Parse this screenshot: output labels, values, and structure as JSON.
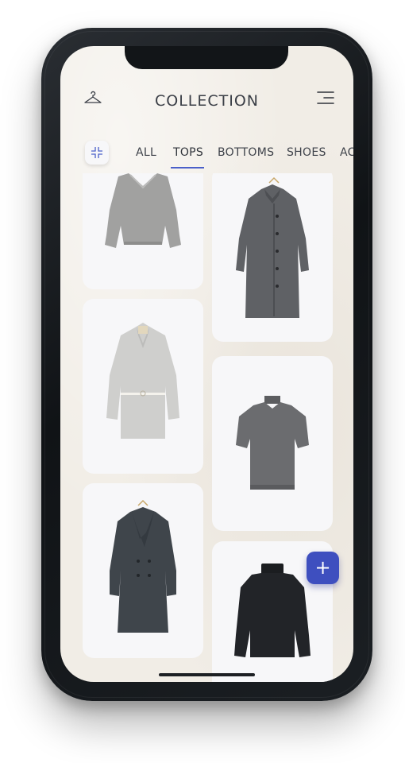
{
  "header": {
    "title": "COLLECTION",
    "left_icon": "hanger-icon",
    "right_icon": "menu-icon"
  },
  "filter_button": {
    "icon": "collapse-icon"
  },
  "tabs": [
    {
      "label": "ALL",
      "active": false
    },
    {
      "label": "TOPS",
      "active": true
    },
    {
      "label": "BOTTOMS",
      "active": false
    },
    {
      "label": "SHOES",
      "active": false
    },
    {
      "label": "AC",
      "active": false
    }
  ],
  "items": [
    {
      "kind": "grey-sweater",
      "color": "#9a9a9a"
    },
    {
      "kind": "grey-tweed-coat",
      "color": "#5d5f63"
    },
    {
      "kind": "light-grey-belted-coat",
      "color": "#c9c9c7"
    },
    {
      "kind": "grey-short-sleeve-knit",
      "color": "#6a6b6e"
    },
    {
      "kind": "dark-grey-double-breasted-coat",
      "color": "#3e4449"
    },
    {
      "kind": "black-turtleneck",
      "color": "#1f2124"
    }
  ],
  "fab": {
    "label": "+",
    "color": "#3e4fbf"
  },
  "colors": {
    "accent": "#4a5fc9",
    "background": "#f1ede6",
    "card": "#f7f7f9"
  }
}
